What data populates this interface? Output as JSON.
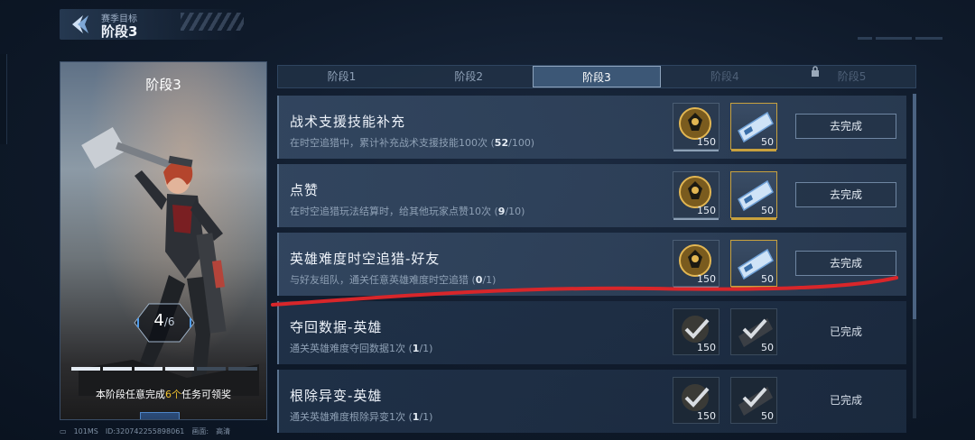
{
  "header": {
    "subtitle": "赛季目标",
    "title": "阶段3"
  },
  "stage_card": {
    "title": "阶段3",
    "progress_current": "4",
    "progress_total": "6",
    "progress_fraction": 0.667,
    "hint_prefix": "本阶段任意完成",
    "hint_highlight": "6个",
    "hint_suffix": "任务可领奖",
    "reward_count": "1"
  },
  "tabs": [
    {
      "label": "阶段1",
      "state": "normal"
    },
    {
      "label": "阶段2",
      "state": "normal"
    },
    {
      "label": "阶段3",
      "state": "active"
    },
    {
      "label": "阶段4",
      "state": "locked"
    },
    {
      "label": "阶段5",
      "state": "locked"
    }
  ],
  "tasks": [
    {
      "name": "战术支援技能补充",
      "desc_prefix": "在时空追猎中，累计补充战术支援技能100次 (",
      "progress": "52",
      "desc_suffix": "/100)",
      "reward1": "150",
      "reward2": "50",
      "action": "去完成",
      "done": false
    },
    {
      "name": "点赞",
      "desc_prefix": "在时空追猎玩法结算时，给其他玩家点赞10次 (",
      "progress": "9",
      "desc_suffix": "/10)",
      "reward1": "150",
      "reward2": "50",
      "action": "去完成",
      "done": false
    },
    {
      "name": "英雄难度时空追猎-好友",
      "desc_prefix": "与好友组队，通关任意英雄难度时空追猎 (",
      "progress": "0",
      "desc_suffix": "/1)",
      "reward1": "150",
      "reward2": "50",
      "action": "去完成",
      "done": false
    },
    {
      "name": "夺回数据-英雄",
      "desc_prefix": "通关英雄难度夺回数据1次 (",
      "progress": "1",
      "desc_suffix": "/1)",
      "reward1": "150",
      "reward2": "50",
      "action": "已完成",
      "done": true
    },
    {
      "name": "根除异变-英雄",
      "desc_prefix": "通关英雄难度根除异变1次 (",
      "progress": "1",
      "desc_suffix": "/1)",
      "reward1": "150",
      "reward2": "50",
      "action": "已完成",
      "done": true
    }
  ],
  "footer": {
    "ping": "101MS",
    "id": "ID:3207422558980​61",
    "quality_label": "画面:",
    "quality": "高清"
  },
  "colors": {
    "accent_gold": "#c8a13e",
    "highlight_yellow": "#f2c230",
    "annotation_red": "#d8262a"
  }
}
